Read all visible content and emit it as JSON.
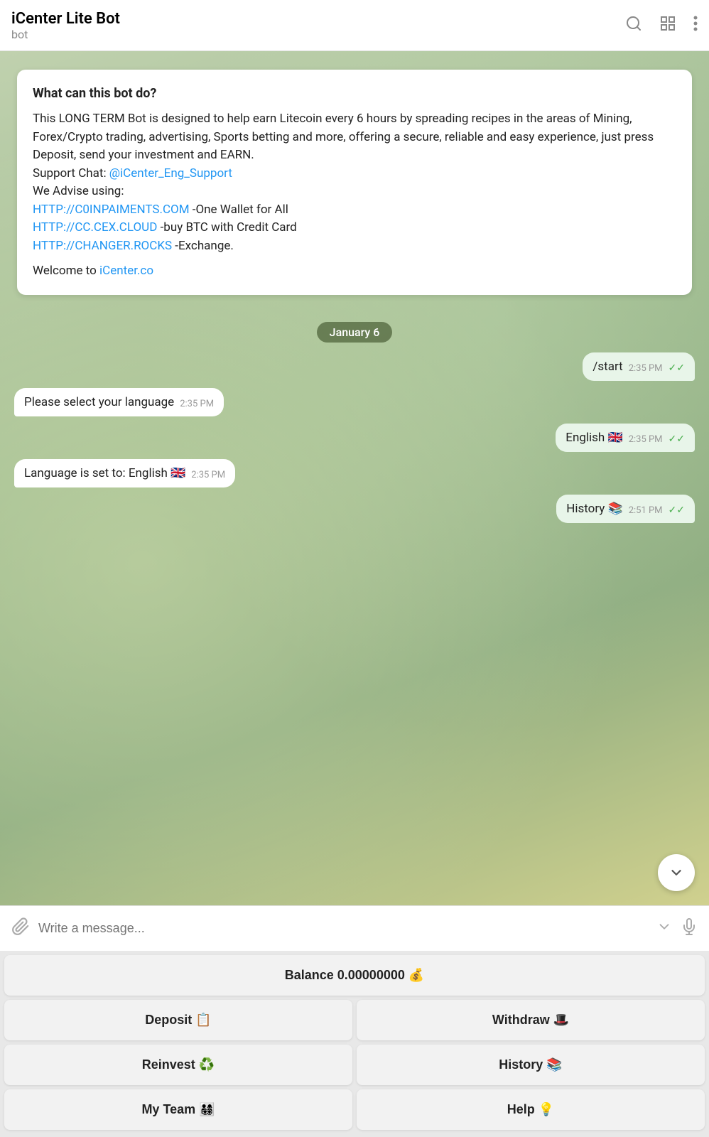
{
  "header": {
    "title": "iCenter Lite Bot",
    "subtitle": "bot",
    "search_label": "search",
    "grid_label": "grid",
    "more_label": "more"
  },
  "bot_card": {
    "title": "What can this bot do?",
    "description": "This LONG TERM Bot is designed to help earn Litecoin every 6 hours by spreading recipes in the areas of Mining, Forex/Crypto trading, advertising, Sports betting and more, offering a secure, reliable and easy experience, just press Deposit, send your investment and EARN.",
    "support_label": "Support Chat: ",
    "support_link": "@iCenter_Eng_Support",
    "advise_label": "We Advise using:",
    "link1": "HTTP://C0INPAIMENTS.COM",
    "link1_suffix": " -One Wallet for All",
    "link2": "HTTP://CC.CEX.CLOUD",
    "link2_suffix": " -buy BTC with Credit Card",
    "link3": "HTTP://CHANGER.ROCKS",
    "link3_suffix": " -Exchange.",
    "welcome": "Welcome to ",
    "welcome_link": "iCenter.co"
  },
  "date_badge": {
    "label": "January 6"
  },
  "messages": [
    {
      "id": 1,
      "type": "outgoing",
      "text": "/start",
      "time": "2:35 PM",
      "ticks": true
    },
    {
      "id": 2,
      "type": "incoming",
      "text": "Please select your language",
      "time": "2:35 PM",
      "ticks": false
    },
    {
      "id": 3,
      "type": "outgoing",
      "text": "English 🇬🇧",
      "time": "2:35 PM",
      "ticks": true
    },
    {
      "id": 4,
      "type": "incoming",
      "text": "Language is set to: English 🇬🇧",
      "time": "2:35 PM",
      "ticks": false
    },
    {
      "id": 5,
      "type": "outgoing",
      "text": "History 📚",
      "time": "2:51 PM",
      "ticks": true
    }
  ],
  "input_bar": {
    "placeholder": "Write a message..."
  },
  "keyboard": {
    "balance_label": "Balance 0.00000000 💰",
    "buttons": [
      [
        {
          "label": "Deposit 📋",
          "name": "deposit-button"
        },
        {
          "label": "Withdraw 🎩",
          "name": "withdraw-button"
        }
      ],
      [
        {
          "label": "Reinvest ♻️",
          "name": "reinvest-button"
        },
        {
          "label": "History 📚",
          "name": "history-button"
        }
      ],
      [
        {
          "label": "My Team 👨‍👩‍👧‍👦",
          "name": "my-team-button"
        },
        {
          "label": "Help 💡",
          "name": "help-button"
        }
      ]
    ]
  }
}
